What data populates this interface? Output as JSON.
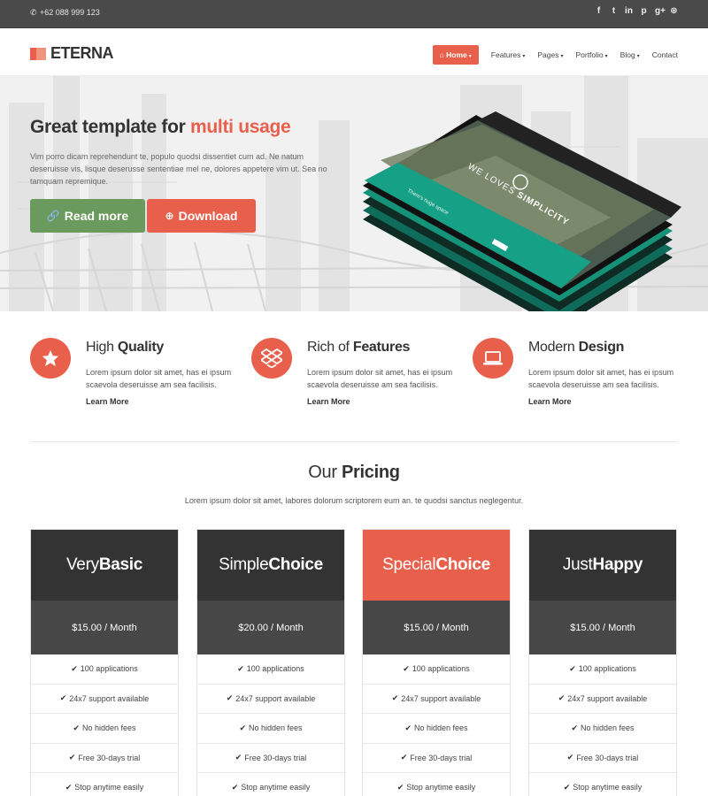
{
  "topbar": {
    "phone": "+62 088 999 123",
    "phone_icon": "phone-icon",
    "socials": [
      {
        "icon": "facebook-icon",
        "glyph": "f"
      },
      {
        "icon": "twitter-icon",
        "glyph": "t"
      },
      {
        "icon": "linkedin-icon",
        "glyph": "in"
      },
      {
        "icon": "pinterest-icon",
        "glyph": "p"
      },
      {
        "icon": "google-plus-icon",
        "glyph": "g+"
      },
      {
        "icon": "dribbble-icon",
        "glyph": "⊛"
      }
    ]
  },
  "header": {
    "logo": "ETERNA",
    "nav": [
      {
        "label": "Home",
        "active": true,
        "caret": true
      },
      {
        "label": "Features",
        "caret": true
      },
      {
        "label": "Pages",
        "caret": true
      },
      {
        "label": "Portfolio",
        "caret": true
      },
      {
        "label": "Blog",
        "caret": true
      },
      {
        "label": "Contact",
        "caret": false
      }
    ]
  },
  "hero": {
    "title_main": "Great template for ",
    "title_accent": "multi usage",
    "text": "Vim porro dicam reprehendunt te, populo quodsi dissentiet cum ad. Ne natum deseruisse vis, lisque deserusse sententiae mel ne, dolores appetere vim ut. Sea no tamquam repremique.",
    "read_more": "Read more",
    "download": "Download",
    "mockup_caption_1": "WE LOVES",
    "mockup_caption_2": "SIMPLICITY",
    "mockup_ribbon": "There's huge space"
  },
  "features": [
    {
      "title_light": "High ",
      "title_bold": "Quality",
      "icon": "star-icon",
      "text": "Lorem ipsum dolor sit amet, has ei ipsum scaevola deseruisse am sea facilisis.",
      "more": "Learn More"
    },
    {
      "title_light": "Rich of ",
      "title_bold": "Features",
      "icon": "dropbox-icon",
      "text": "Lorem ipsum dolor sit amet, has ei ipsum scaevola deseruisse am sea facilisis.",
      "more": "Learn More"
    },
    {
      "title_light": "Modern ",
      "title_bold": "Design",
      "icon": "laptop-icon",
      "text": "Lorem ipsum dolor sit amet, has ei ipsum scaevola deseruisse am sea facilisis.",
      "more": "Learn More"
    }
  ],
  "pricing": {
    "title_light": "Our ",
    "title_bold": "Pricing",
    "subtitle": "Lorem ipsum dolor sit amet, labores dolorum scriptorem eum an. te quodsi sanctus neglegentur.",
    "plans": [
      {
        "name_light": "Very ",
        "name_bold": "Basic",
        "price": "$15.00 / Month",
        "special": false
      },
      {
        "name_light": "Simple ",
        "name_bold": "Choice",
        "price": "$20.00 / Month",
        "special": false
      },
      {
        "name_light": "Special ",
        "name_bold": "Choice",
        "price": "$15.00 / Month",
        "special": true
      },
      {
        "name_light": "Just ",
        "name_bold": "Happy",
        "price": "$15.00 / Month",
        "special": false
      }
    ],
    "features": [
      "100 applications",
      "24x7 support available",
      "No hidden fees",
      "Free 30-days trial",
      "Stop anytime easily"
    ]
  },
  "colors": {
    "accent": "#e8604c",
    "green": "#6b9a5e",
    "dark": "#333333",
    "teal": "#16a085"
  }
}
